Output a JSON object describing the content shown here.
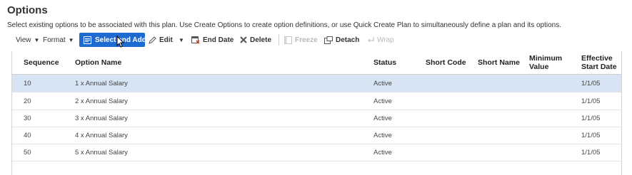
{
  "page": {
    "title": "Options",
    "description": "Select existing options to be associated with this plan. Use Create Options to create option definitions, or use Quick Create Plan to simultaneously define a plan and its options."
  },
  "toolbar": {
    "view_label": "View",
    "format_label": "Format",
    "select_add_label": "Select and Add",
    "edit_label": "Edit",
    "end_date_label": "End Date",
    "delete_label": "Delete",
    "freeze_label": "Freeze",
    "detach_label": "Detach",
    "wrap_label": "Wrap"
  },
  "table": {
    "columns": {
      "sequence": "Sequence",
      "option_name": "Option Name",
      "status": "Status",
      "short_code": "Short Code",
      "short_name": "Short Name",
      "minimum_value": "Minimum Value",
      "effective_start_date": "Effective Start Date"
    },
    "rows": [
      {
        "sequence": "10",
        "option_name": "1 x Annual Salary",
        "status": "Active",
        "short_code": "",
        "short_name": "",
        "minimum_value": "",
        "effective_start_date": "1/1/05"
      },
      {
        "sequence": "20",
        "option_name": "2 x Annual Salary",
        "status": "Active",
        "short_code": "",
        "short_name": "",
        "minimum_value": "",
        "effective_start_date": "1/1/05"
      },
      {
        "sequence": "30",
        "option_name": "3 x Annual Salary",
        "status": "Active",
        "short_code": "",
        "short_name": "",
        "minimum_value": "",
        "effective_start_date": "1/1/05"
      },
      {
        "sequence": "40",
        "option_name": "4 x Annual Salary",
        "status": "Active",
        "short_code": "",
        "short_name": "",
        "minimum_value": "",
        "effective_start_date": "1/1/05"
      },
      {
        "sequence": "50",
        "option_name": "5 x Annual Salary",
        "status": "Active",
        "short_code": "",
        "short_name": "",
        "minimum_value": "",
        "effective_start_date": "1/1/05"
      }
    ],
    "selected_row": "10"
  },
  "colors": {
    "primary_button": "#1f6ad0",
    "selected_row": "#d6e4f3",
    "disabled_text": "#b8b8b8"
  },
  "icons": [
    "caret-down-icon",
    "select-add-icon",
    "pencil-icon",
    "end-date-icon",
    "delete-x-icon",
    "freeze-icon",
    "detach-icon",
    "wrap-icon",
    "mouse-pointer-icon"
  ]
}
